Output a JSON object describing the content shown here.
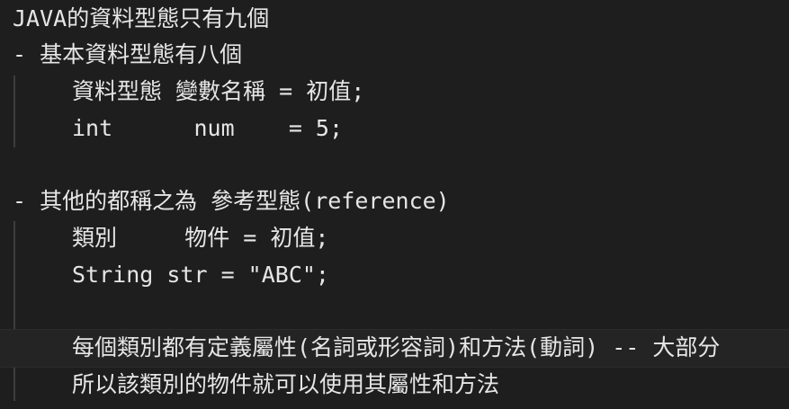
{
  "editor": {
    "lines": [
      "JAVA的資料型態只有九個",
      "- 基本資料型態有八個",
      "資料型態 變數名稱 = 初值;",
      "int      num    = 5;",
      "",
      "- 其他的都稱之為 參考型態(reference)",
      "類別     物件 = 初值;",
      "String str = \"ABC\";",
      "",
      "每個類別都有定義屬性(名詞或形容詞)和方法(動詞) -- 大部分",
      "所以該類別的物件就可以使用其屬性和方法"
    ]
  },
  "colors": {
    "background": "#1e1e1e",
    "text": "#e6e6e6",
    "indent_guide": "#3e3e3e",
    "current_line": "#242424"
  }
}
